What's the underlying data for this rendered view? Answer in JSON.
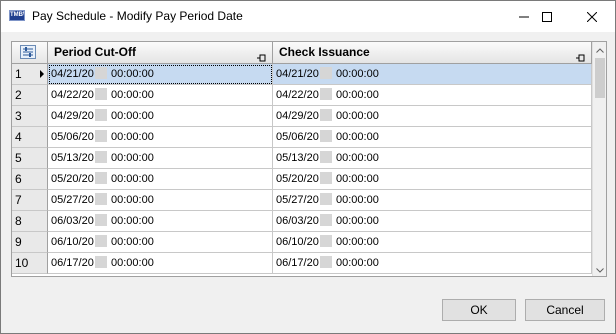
{
  "window": {
    "title": "Pay Schedule - Modify Pay Period Date",
    "icon_text": "TMBW"
  },
  "grid": {
    "columns": [
      {
        "label": "Period Cut-Off"
      },
      {
        "label": "Check Issuance"
      }
    ],
    "rows": [
      {
        "num": "1",
        "cutoff_date": "04/21/20",
        "cutoff_time": "00:00:00",
        "check_date": "04/21/20",
        "check_time": "00:00:00",
        "selected": true
      },
      {
        "num": "2",
        "cutoff_date": "04/22/20",
        "cutoff_time": "00:00:00",
        "check_date": "04/22/20",
        "check_time": "00:00:00"
      },
      {
        "num": "3",
        "cutoff_date": "04/29/20",
        "cutoff_time": "00:00:00",
        "check_date": "04/29/20",
        "check_time": "00:00:00"
      },
      {
        "num": "4",
        "cutoff_date": "05/06/20",
        "cutoff_time": "00:00:00",
        "check_date": "05/06/20",
        "check_time": "00:00:00"
      },
      {
        "num": "5",
        "cutoff_date": "05/13/20",
        "cutoff_time": "00:00:00",
        "check_date": "05/13/20",
        "check_time": "00:00:00"
      },
      {
        "num": "6",
        "cutoff_date": "05/20/20",
        "cutoff_time": "00:00:00",
        "check_date": "05/20/20",
        "check_time": "00:00:00"
      },
      {
        "num": "7",
        "cutoff_date": "05/27/20",
        "cutoff_time": "00:00:00",
        "check_date": "05/27/20",
        "check_time": "00:00:00"
      },
      {
        "num": "8",
        "cutoff_date": "06/03/20",
        "cutoff_time": "00:00:00",
        "check_date": "06/03/20",
        "check_time": "00:00:00"
      },
      {
        "num": "9",
        "cutoff_date": "06/10/20",
        "cutoff_time": "00:00:00",
        "check_date": "06/10/20",
        "check_time": "00:00:00"
      },
      {
        "num": "10",
        "cutoff_date": "06/17/20",
        "cutoff_time": "00:00:00",
        "check_date": "06/17/20",
        "check_time": "00:00:00"
      }
    ]
  },
  "buttons": {
    "ok": "OK",
    "cancel": "Cancel"
  },
  "icons": {
    "minimize": "minimize-icon",
    "maximize": "maximize-icon",
    "close": "close-icon",
    "column_chooser": "column-chooser-icon",
    "pin": "pin-icon",
    "row_indicator": "row-indicator-arrow-icon"
  },
  "colors": {
    "selected_row": "#c6daf1",
    "dialog_bg": "#f0f0f0"
  }
}
